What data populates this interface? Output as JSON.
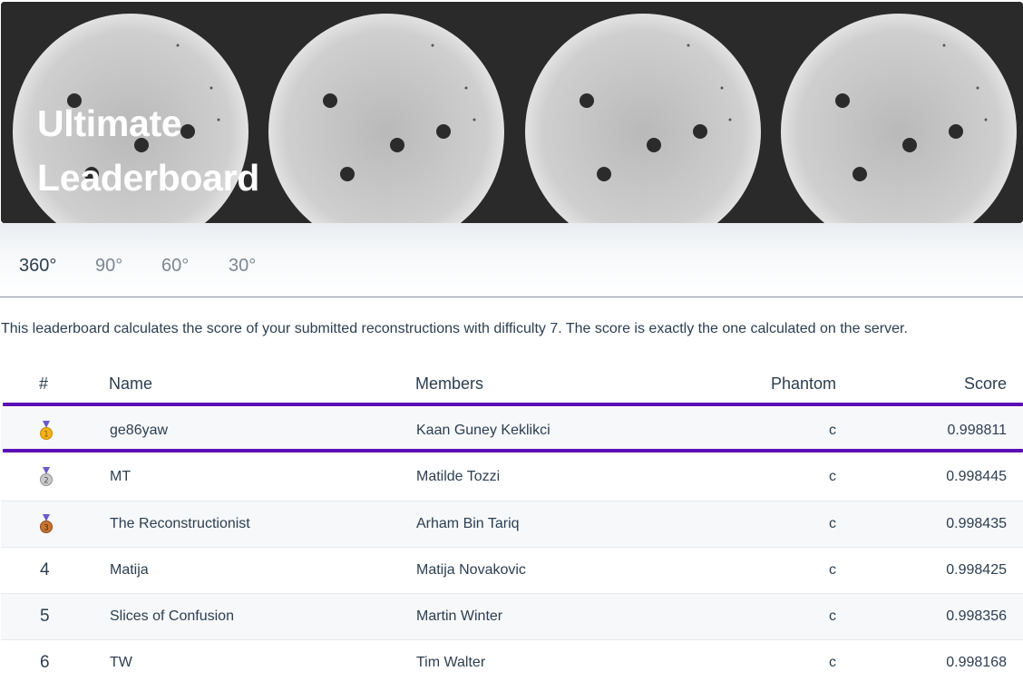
{
  "hero": {
    "title": "Ultimate Leaderboard"
  },
  "tabs": [
    {
      "label": "360°",
      "active": true
    },
    {
      "label": "90°",
      "active": false
    },
    {
      "label": "60°",
      "active": false
    },
    {
      "label": "30°",
      "active": false
    }
  ],
  "description": "This leaderboard calculates the score of your submitted reconstructions with difficulty 7. The score is exactly the one calculated on the server.",
  "table": {
    "headers": {
      "rank": "#",
      "name": "Name",
      "members": "Members",
      "phantom": "Phantom",
      "score": "Score"
    },
    "rows": [
      {
        "rank": "1",
        "medal": "gold",
        "name": "ge86yaw",
        "members": "Kaan Guney Keklikci",
        "phantom": "c",
        "score": "0.998811"
      },
      {
        "rank": "2",
        "medal": "silver",
        "name": "MT",
        "members": "Matilde Tozzi",
        "phantom": "c",
        "score": "0.998445"
      },
      {
        "rank": "3",
        "medal": "bronze",
        "name": "The Reconstructionist",
        "members": "Arham Bin Tariq",
        "phantom": "c",
        "score": "0.998435"
      },
      {
        "rank": "4",
        "medal": "",
        "name": "Matija",
        "members": "Matija Novakovic",
        "phantom": "c",
        "score": "0.998425"
      },
      {
        "rank": "5",
        "medal": "",
        "name": "Slices of Confusion",
        "members": "Martin Winter",
        "phantom": "c",
        "score": "0.998356"
      },
      {
        "rank": "6",
        "medal": "",
        "name": "TW",
        "members": "Tim Walter",
        "phantom": "c",
        "score": "0.998168"
      }
    ]
  },
  "colors": {
    "highlight": "#5b0fb6",
    "text": "#2c3e50",
    "muted_tab": "#7d8790"
  }
}
